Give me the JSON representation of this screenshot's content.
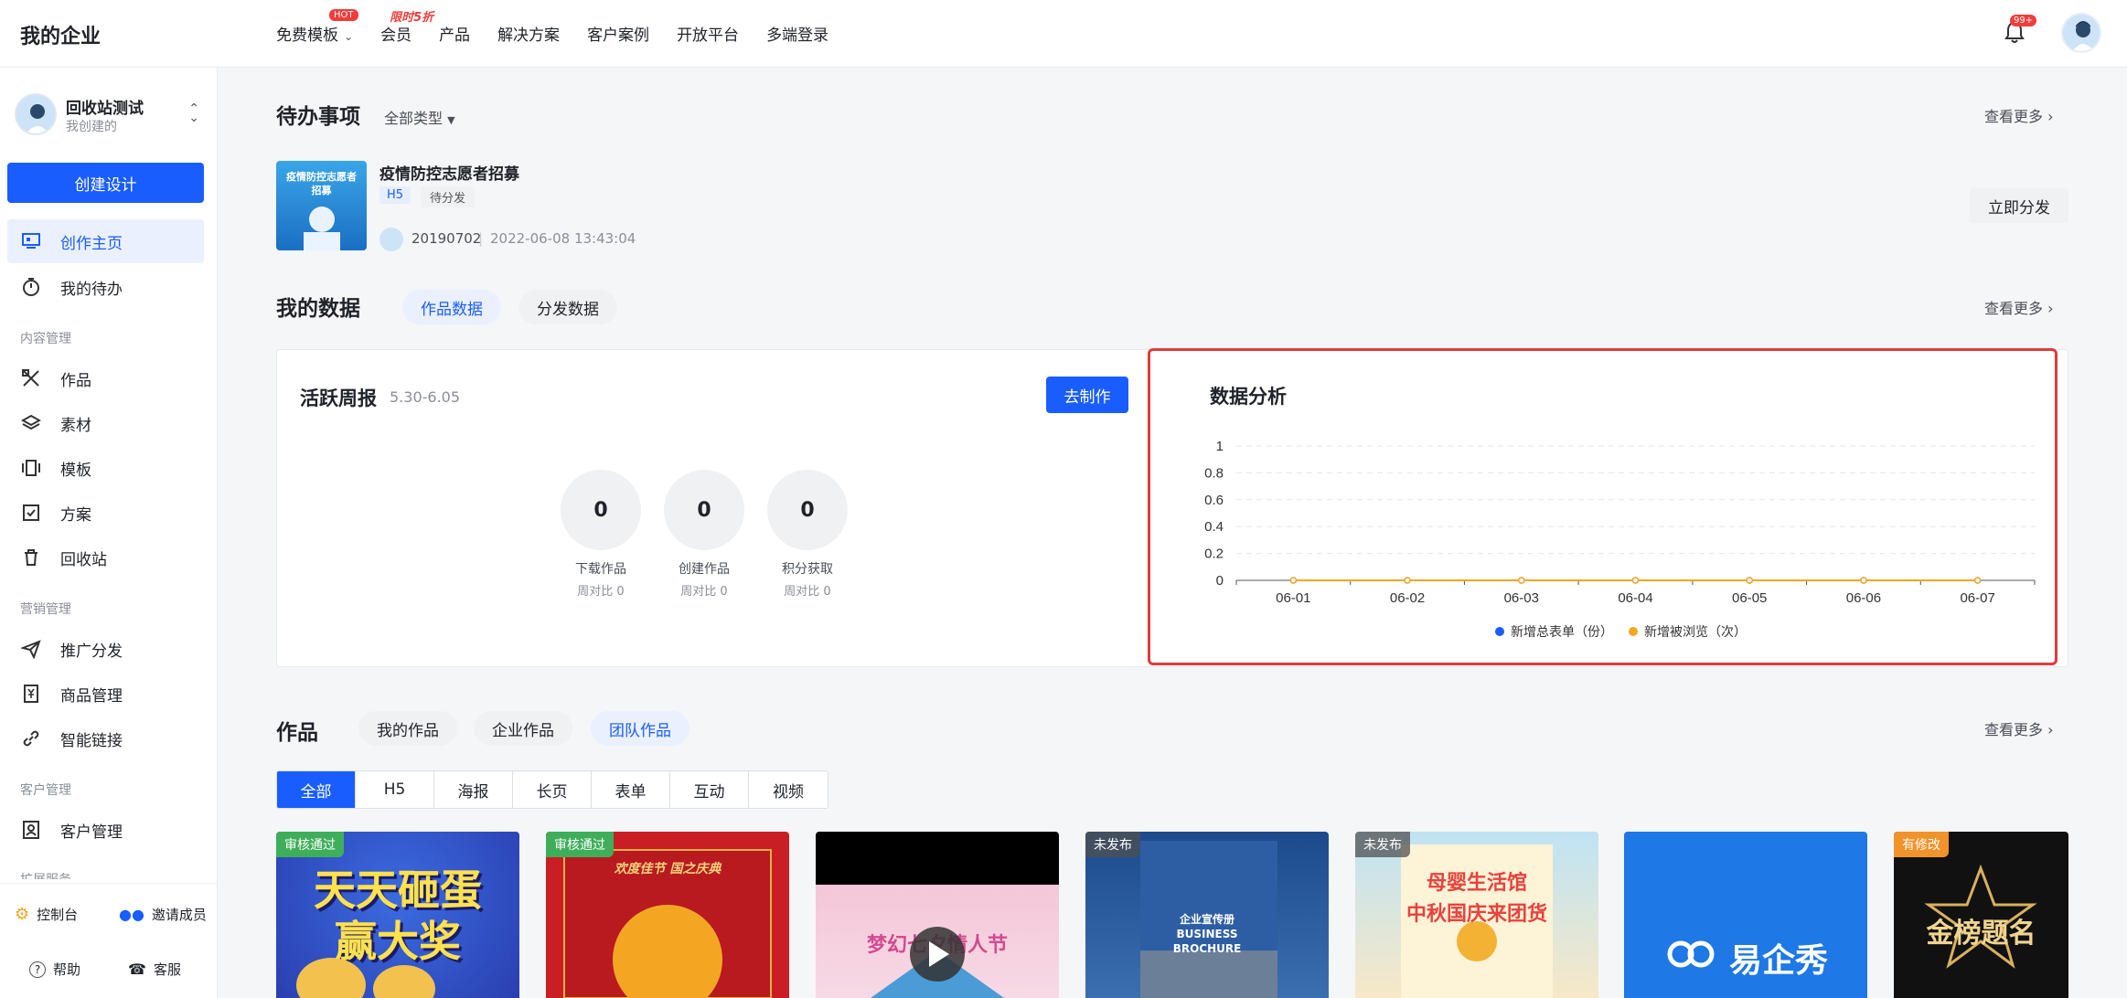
{
  "header": {
    "brand": "我的企业",
    "nav": [
      {
        "label": "免费模板",
        "badge": "HOT"
      },
      {
        "label": "会员",
        "promo": "限时5折"
      },
      {
        "label": "产品"
      },
      {
        "label": "解决方案"
      },
      {
        "label": "客户案例"
      },
      {
        "label": "开放平台"
      },
      {
        "label": "多端登录"
      }
    ],
    "notification_count": "99+"
  },
  "sidebar": {
    "workspace_name": "回收站测试",
    "workspace_role": "我创建的",
    "create_button": "创建设计",
    "items_top": [
      {
        "label": "创作主页",
        "icon": "monitor-icon",
        "active": true
      },
      {
        "label": "我的待办",
        "icon": "stopwatch-icon"
      }
    ],
    "section_content": "内容管理",
    "items_content": [
      {
        "label": "作品",
        "icon": "tools-icon"
      },
      {
        "label": "素材",
        "icon": "layers-icon"
      },
      {
        "label": "模板",
        "icon": "carousel-icon"
      },
      {
        "label": "方案",
        "icon": "checklist-icon"
      },
      {
        "label": "回收站",
        "icon": "trash-icon"
      }
    ],
    "section_marketing": "营销管理",
    "items_marketing": [
      {
        "label": "推广分发",
        "icon": "paper-plane-icon"
      },
      {
        "label": "商品管理",
        "icon": "yen-doc-icon"
      },
      {
        "label": "智能链接",
        "icon": "link-icon"
      }
    ],
    "section_customer": "客户管理",
    "items_customer": [
      {
        "label": "客户管理",
        "icon": "contact-icon"
      }
    ],
    "section_ext": "扩展服务",
    "footer": {
      "console": "控制台",
      "invite": "邀请成员",
      "help": "帮助",
      "service": "客服"
    }
  },
  "todo": {
    "title": "待办事项",
    "filter": "全部类型",
    "more": "查看更多",
    "item": {
      "thumb_text": "疫情防控志愿者招募",
      "title": "疫情防控志愿者招募",
      "tag_type": "H5",
      "tag_status": "待分发",
      "user": "20190702",
      "time": "2022-06-08 13:43:04",
      "action": "立即分发"
    }
  },
  "mydata": {
    "title": "我的数据",
    "tabs": [
      "作品数据",
      "分发数据"
    ],
    "more": "查看更多",
    "weekly": {
      "title": "活跃周报",
      "range": "5.30-6.05",
      "action": "去制作",
      "stats": [
        {
          "value": "0",
          "label": "下载作品",
          "sub": "周对比 0"
        },
        {
          "value": "0",
          "label": "创建作品",
          "sub": "周对比 0"
        },
        {
          "value": "0",
          "label": "积分获取",
          "sub": "周对比 0"
        }
      ]
    },
    "analysis_title": "数据分析"
  },
  "chart_data": {
    "type": "line",
    "categories": [
      "06-01",
      "06-02",
      "06-03",
      "06-04",
      "06-05",
      "06-06",
      "06-07"
    ],
    "y_ticks": [
      "0",
      "0.2",
      "0.4",
      "0.6",
      "0.8",
      "1"
    ],
    "ylim": [
      0,
      1
    ],
    "grid": true,
    "legend_position": "bottom",
    "series": [
      {
        "name": "新增总表单（份）",
        "values": [
          0,
          0,
          0,
          0,
          0,
          0,
          0
        ],
        "color": "#1a5dff"
      },
      {
        "name": "新增被浏览（次）",
        "values": [
          0,
          0,
          0,
          0,
          0,
          0,
          0
        ],
        "color": "#f5a623"
      }
    ]
  },
  "works": {
    "title": "作品",
    "tabs": [
      "我的作品",
      "企业作品",
      "团队作品"
    ],
    "active_tab": 2,
    "more": "查看更多",
    "filters": [
      "全部",
      "H5",
      "海报",
      "长页",
      "表单",
      "互动",
      "视频"
    ],
    "cards": [
      {
        "badge": "审核通过",
        "text": "天天砸蛋\n赢大奖"
      },
      {
        "badge": "审核通过",
        "text": "欢度佳节 国之庆典"
      },
      {
        "badge": "",
        "text": "梦幻七夕情人节"
      },
      {
        "badge": "未发布",
        "text": "企业宣传册\nBUSINESS\nBROCHURE"
      },
      {
        "badge": "未发布",
        "text": "母婴生活馆\n中秋国庆来团货"
      },
      {
        "badge": "",
        "text": "易企秀"
      },
      {
        "badge": "有修改",
        "text": "金榜题名"
      }
    ]
  }
}
